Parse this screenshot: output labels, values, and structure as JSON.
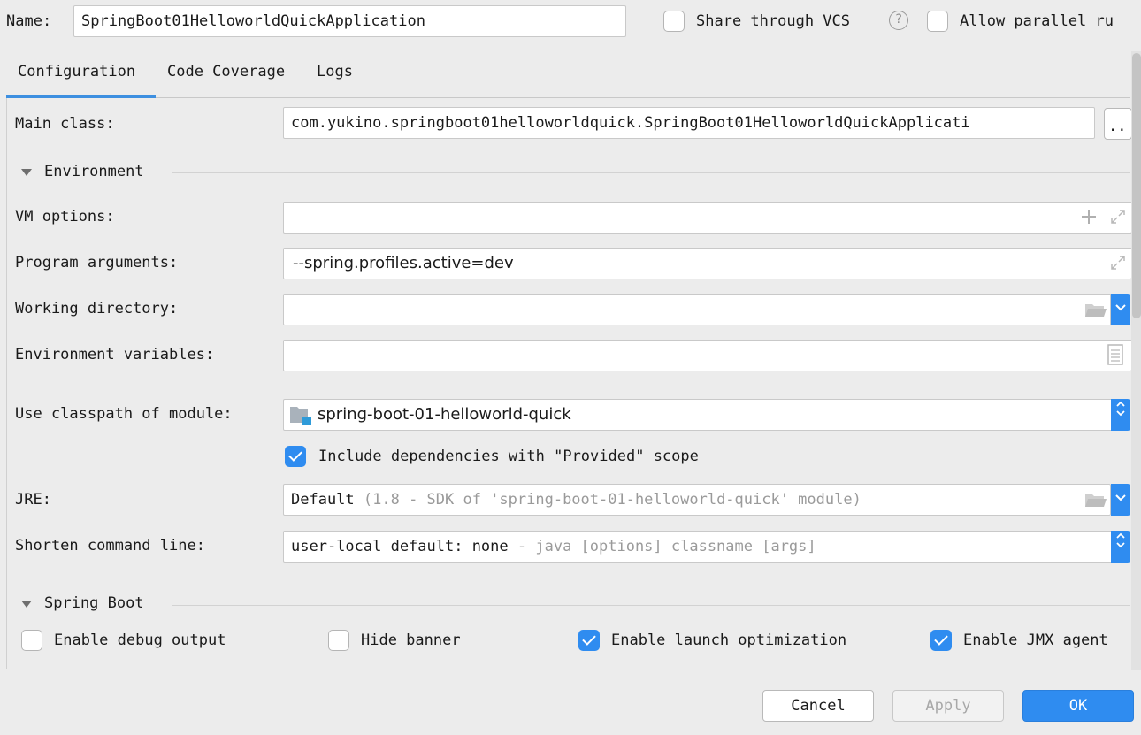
{
  "header": {
    "name_label": "Name:",
    "name_value": "SpringBoot01HelloworldQuickApplication",
    "share_vcs_label": "Share through VCS",
    "allow_parallel_label": "Allow parallel ru"
  },
  "tabs": [
    {
      "label": "Configuration",
      "active": true
    },
    {
      "label": "Code Coverage",
      "active": false
    },
    {
      "label": "Logs",
      "active": false
    }
  ],
  "config": {
    "main_class_label": "Main class:",
    "main_class_value": "com.yukino.springboot01helloworldquick.SpringBoot01HelloworldQuickApplicati",
    "browse_label": "..",
    "environment_section": "Environment",
    "vm_options_label": "VM options:",
    "vm_options_value": "",
    "program_args_label": "Program arguments:",
    "program_args_value": "--spring.profiles.active=dev",
    "working_dir_label": "Working directory:",
    "working_dir_value": "",
    "env_vars_label": "Environment variables:",
    "env_vars_value": "",
    "classpath_label": "Use classpath of module:",
    "classpath_value": "spring-boot-01-helloworld-quick",
    "include_deps_label": "Include dependencies with \"Provided\" scope",
    "include_deps_checked": true,
    "jre_label": "JRE:",
    "jre_value": "Default",
    "jre_hint": "(1.8 - SDK of 'spring-boot-01-helloworld-quick' module)",
    "shorten_label": "Shorten command line:",
    "shorten_value": "user-local default: none",
    "shorten_hint": "- java [options] classname [args]"
  },
  "spring_boot": {
    "section": "Spring Boot",
    "enable_debug_label": "Enable debug output",
    "enable_debug_checked": false,
    "hide_banner_label": "Hide banner",
    "hide_banner_checked": false,
    "launch_opt_label": "Enable launch optimization",
    "launch_opt_checked": true,
    "jmx_label": "Enable JMX agent",
    "jmx_checked": true
  },
  "footer": {
    "cancel_label": "Cancel",
    "apply_label": "Apply",
    "ok_label": "OK"
  },
  "colors": {
    "accent": "#2f8cf0",
    "tab_underline": "#3d8fe0",
    "background": "#ececec"
  }
}
